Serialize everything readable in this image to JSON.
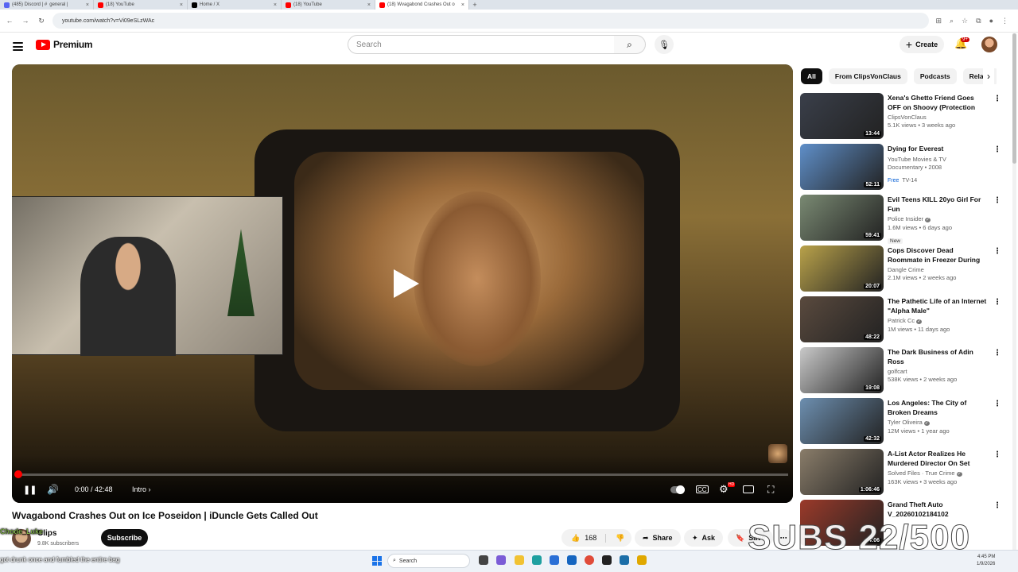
{
  "browser": {
    "tabs": [
      {
        "label": "(485) Discord | #",
        "label2": "general |",
        "active": false,
        "color": "#5865f2"
      },
      {
        "label": "(18) YouTube",
        "active": false,
        "color": "#ff0000"
      },
      {
        "label": "Home / X",
        "active": false,
        "color": "#000000"
      },
      {
        "label": "(18) YouTube",
        "active": false,
        "color": "#ff0000"
      },
      {
        "label": "(18) Wvagabond Crashes Out o",
        "active": true,
        "color": "#ff0000"
      }
    ],
    "new_tab_label": "+",
    "url": "youtube.com/watch?v=Vi09eSLzWAc"
  },
  "masthead": {
    "logo_text": "Premium",
    "search_placeholder": "Search",
    "create_label": "Create",
    "notification_count": "9+"
  },
  "player": {
    "time": "0:00 / 42:48",
    "chapter": "Intro",
    "progress": 0.004,
    "hd_badge": "HD"
  },
  "video": {
    "title": "Wvagabond Crashes Out on Ice Poseidon | iDuncle Gets Called Out",
    "channel": "Clips",
    "subscribers": "9.8K subscribers",
    "subscribe_label": "Subscribe",
    "likes": "168",
    "share_label": "Share",
    "ask_label": "Ask",
    "save_label": "Save"
  },
  "sidebar": {
    "chips": [
      {
        "label": "All",
        "active": true
      },
      {
        "label": "From ClipsVonClaus",
        "active": false
      },
      {
        "label": "Podcasts",
        "active": false
      },
      {
        "label": "Related",
        "active": false
      }
    ],
    "recommendations": [
      {
        "title": "Xena's Ghetto Friend Goes OFF on Shoovy (Protection Order ...",
        "channel": "ClipsVonClaus",
        "stats": "5.1K views • 3 weeks ago",
        "duration": "13:44",
        "verified": false,
        "color": "#3a3f4a"
      },
      {
        "title": "Dying for Everest",
        "channel": "YouTube Movies & TV",
        "stats": "Documentary • 2008",
        "free": "Free",
        "rating": "TV-14",
        "duration": "52:11",
        "verified": false,
        "color": "#5f8fc9"
      },
      {
        "title": "Evil Teens KILL 20yo Girl For Fun",
        "channel": "Police Insider",
        "stats": "1.6M views • 6 days ago",
        "badge": "New",
        "duration": "59:41",
        "verified": true,
        "color": "#7a8a73"
      },
      {
        "title": "Cops Discover Dead Roommate in Freezer During Welfare Check",
        "channel": "Dangle Crime",
        "stats": "2.1M views • 2 weeks ago",
        "duration": "20:07",
        "verified": false,
        "color": "#b9a24a"
      },
      {
        "title": "The Pathetic Life of an Internet \"Alpha Male\"",
        "channel": "Patrick Cc",
        "stats": "1M views • 11 days ago",
        "duration": "48:22",
        "verified": true,
        "color": "#5a4a3e"
      },
      {
        "title": "The Dark Business of Adin Ross",
        "channel": "golfcart",
        "stats": "538K views • 2 weeks ago",
        "duration": "19:08",
        "verified": false,
        "color": "#c9c9c9"
      },
      {
        "title": "Los Angeles: The City of Broken Dreams",
        "channel": "Tyler Oliveira",
        "stats": "12M views • 1 year ago",
        "duration": "42:32",
        "verified": true,
        "color": "#6d8fb0"
      },
      {
        "title": "A-List Actor Realizes He Murdered Director On Set",
        "channel": "Solved Files · True Crime",
        "stats": "163K views • 3 weeks ago",
        "duration": "1:06:46",
        "verified": true,
        "color": "#8a7d6a"
      },
      {
        "title": "Grand Theft Auto V_20260102184102",
        "channel": "",
        "stats": "",
        "duration": "4:06",
        "verified": false,
        "color": "#9b3a2a"
      }
    ]
  },
  "overlays": {
    "subs_counter": "SUBS 22/500",
    "chat_name": "Chode_Luke",
    "chat_message": "got drunk once and fumbled the entire bag"
  },
  "taskbar": {
    "search_label": "Search",
    "time": "4:45 PM",
    "date": "1/9/2026"
  }
}
